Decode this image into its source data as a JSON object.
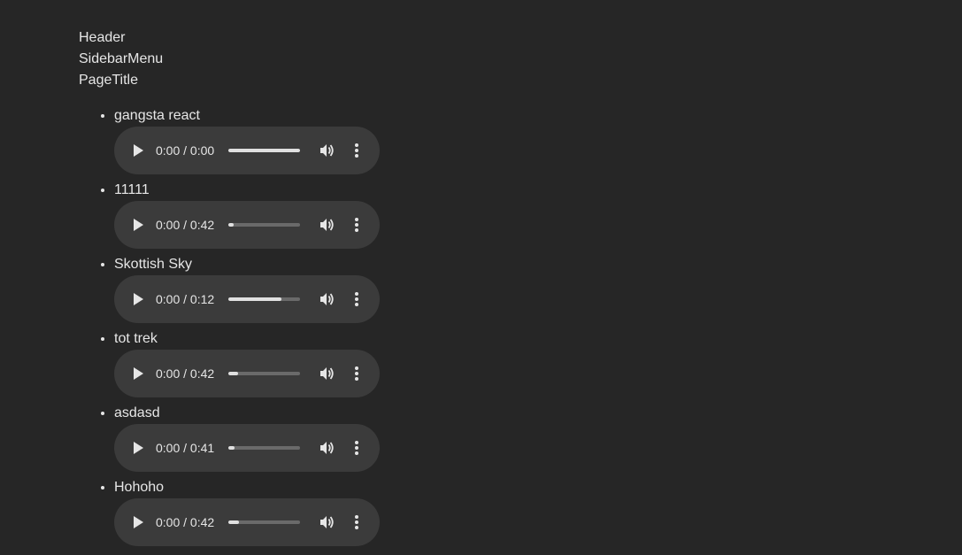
{
  "nav": {
    "header": "Header",
    "sidebar": "SidebarMenu",
    "page_title": "PageTitle"
  },
  "tracks": [
    {
      "title": "gangsta react",
      "time": "0:00 / 0:00",
      "buffered": 1.0
    },
    {
      "title": "11111",
      "time": "0:00 / 0:42",
      "buffered": 0.08
    },
    {
      "title": "Skottish Sky",
      "time": "0:00 / 0:12",
      "buffered": 0.74
    },
    {
      "title": "tot trek",
      "time": "0:00 / 0:42",
      "buffered": 0.14
    },
    {
      "title": "asdasd",
      "time": "0:00 / 0:41",
      "buffered": 0.09
    },
    {
      "title": "Hohoho",
      "time": "0:00 / 0:42",
      "buffered": 0.15
    }
  ],
  "icons": {
    "play": "play-icon",
    "volume": "volume-icon",
    "more": "more-vertical-icon"
  },
  "colors": {
    "background": "#262626",
    "player_background": "#3b3b3b",
    "text": "#e6e6e6"
  }
}
